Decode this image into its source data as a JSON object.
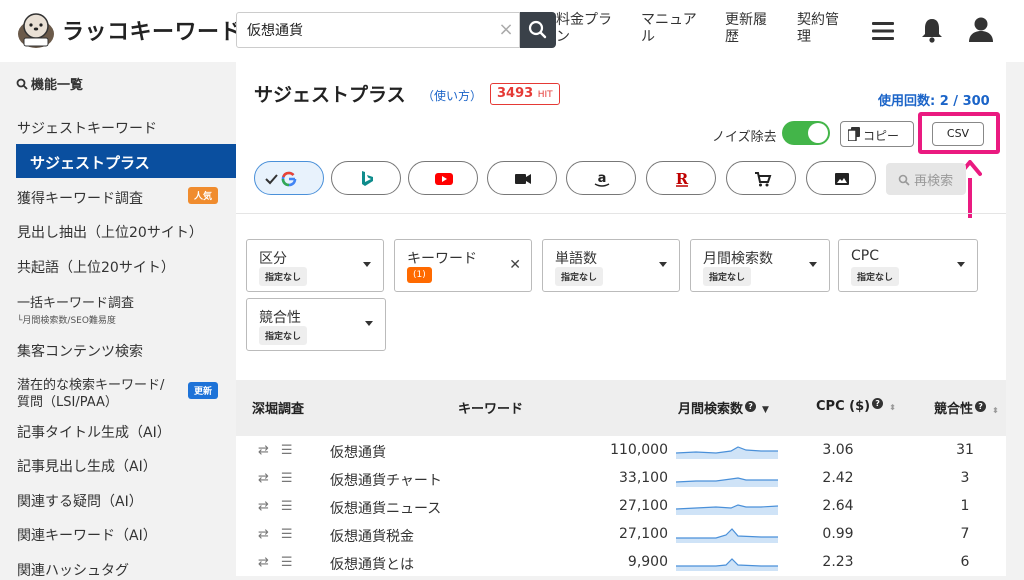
{
  "header": {
    "logo_text": "ラッコキーワード",
    "search_value": "仮想通貨",
    "nav": [
      "料金プラン",
      "マニュアル",
      "更新履歴",
      "契約管理"
    ]
  },
  "sidebar": {
    "section_title": "機能一覧",
    "items": [
      {
        "label": "サジェストキーワード"
      },
      {
        "label": "サジェストプラス",
        "active": true
      },
      {
        "label": "獲得キーワード調査",
        "badge": "人気"
      },
      {
        "label": "見出し抽出（上位20サイト）"
      },
      {
        "label": "共起語（上位20サイト）"
      },
      {
        "label": "一括キーワード調査",
        "sub": "└月間検索数/SEO難易度"
      },
      {
        "label": "集客コンテンツ検索"
      },
      {
        "label": "潜在的な検索キーワード/",
        "label2": "質問（LSI/PAA）",
        "badge": "更新"
      },
      {
        "label": "記事タイトル生成（AI）"
      },
      {
        "label": "記事見出し生成（AI）"
      },
      {
        "label": "関連する疑問（AI）"
      },
      {
        "label": "関連キーワード（AI）"
      },
      {
        "label": "関連ハッシュタグ"
      }
    ]
  },
  "main": {
    "title": "サジェストプラス",
    "howto": "（使い方）",
    "hit_count": "3493",
    "hit_unit": "HIT",
    "usage": "使用回数: 2 / 300",
    "noise_label": "ノイズ除去",
    "noise_on": true,
    "copy_label": "コピー",
    "csv_label": "CSV",
    "research_label": "再検索",
    "engines": [
      "google",
      "bing",
      "youtube",
      "video",
      "amazon",
      "rakuten",
      "cart",
      "image"
    ],
    "active_engine": "google"
  },
  "filters": [
    {
      "label": "区分",
      "value": "指定なし"
    },
    {
      "label": "キーワード",
      "value": "(1)",
      "clearable": true
    },
    {
      "label": "単語数",
      "value": "指定なし"
    },
    {
      "label": "月間検索数",
      "value": "指定なし"
    },
    {
      "label": "CPC",
      "value": "指定なし"
    },
    {
      "label": "競合性",
      "value": "指定なし"
    }
  ],
  "table": {
    "columns": [
      "深堀調査",
      "キーワード",
      "月間検索数",
      "CPC ($)",
      "競合性"
    ],
    "rows": [
      {
        "keyword": "仮想通貨",
        "volume": "110,000",
        "cpc": "3.06",
        "competition": "31"
      },
      {
        "keyword": "仮想通貨チャート",
        "volume": "33,100",
        "cpc": "2.42",
        "competition": "3"
      },
      {
        "keyword": "仮想通貨ニュース",
        "volume": "27,100",
        "cpc": "2.64",
        "competition": "1"
      },
      {
        "keyword": "仮想通貨税金",
        "volume": "27,100",
        "cpc": "0.99",
        "competition": "7"
      },
      {
        "keyword": "仮想通貨とは",
        "volume": "9,900",
        "cpc": "2.23",
        "competition": "6"
      }
    ]
  },
  "colors": {
    "accent": "#0a4f9f",
    "link": "#1b64c8",
    "highlight": "#ea1a80",
    "toggle": "#43b549",
    "badge_popular": "#f08c2e",
    "badge_update": "#1e73d8"
  }
}
